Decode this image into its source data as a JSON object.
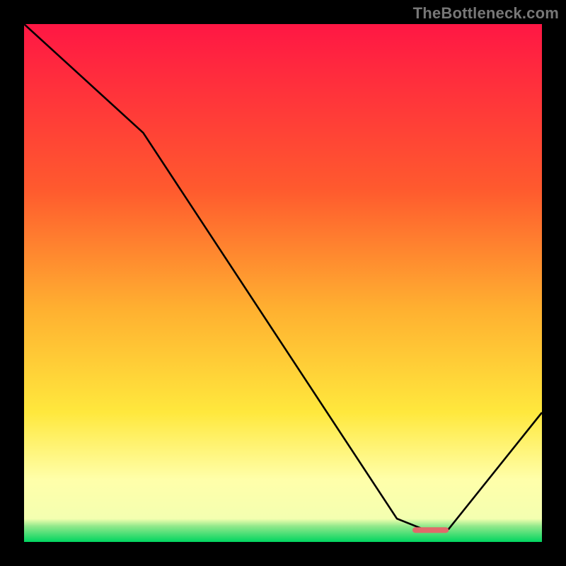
{
  "watermark": "TheBottleneck.com",
  "colors": {
    "red_top": "#ff1744",
    "orange": "#ff7a2a",
    "yellow": "#ffe83d",
    "pale_yellow": "#ffffaa",
    "green": "#00d560",
    "line": "#000000",
    "marker": "#e06a6a",
    "frame_bg": "#000000"
  },
  "chart_data": {
    "type": "line",
    "title": "",
    "xlabel": "",
    "ylabel": "",
    "xlim": [
      0,
      100
    ],
    "ylim": [
      0,
      100
    ],
    "grid": false,
    "legend": false,
    "series": [
      {
        "name": "curve",
        "x": [
          0,
          23,
          72,
          77,
          82,
          100
        ],
        "y": [
          100,
          79,
          4.5,
          2.5,
          2.5,
          25
        ]
      }
    ],
    "marker": {
      "x_start": 75,
      "x_end": 82,
      "y": 2.3
    },
    "background_gradient_stops": [
      {
        "offset": 0.0,
        "color": "#ff1744"
      },
      {
        "offset": 0.32,
        "color": "#ff5a2e"
      },
      {
        "offset": 0.55,
        "color": "#ffb030"
      },
      {
        "offset": 0.75,
        "color": "#ffe83d"
      },
      {
        "offset": 0.88,
        "color": "#ffffaa"
      },
      {
        "offset": 0.955,
        "color": "#f4ffb0"
      },
      {
        "offset": 0.97,
        "color": "#8fe88a"
      },
      {
        "offset": 1.0,
        "color": "#00d560"
      }
    ]
  }
}
